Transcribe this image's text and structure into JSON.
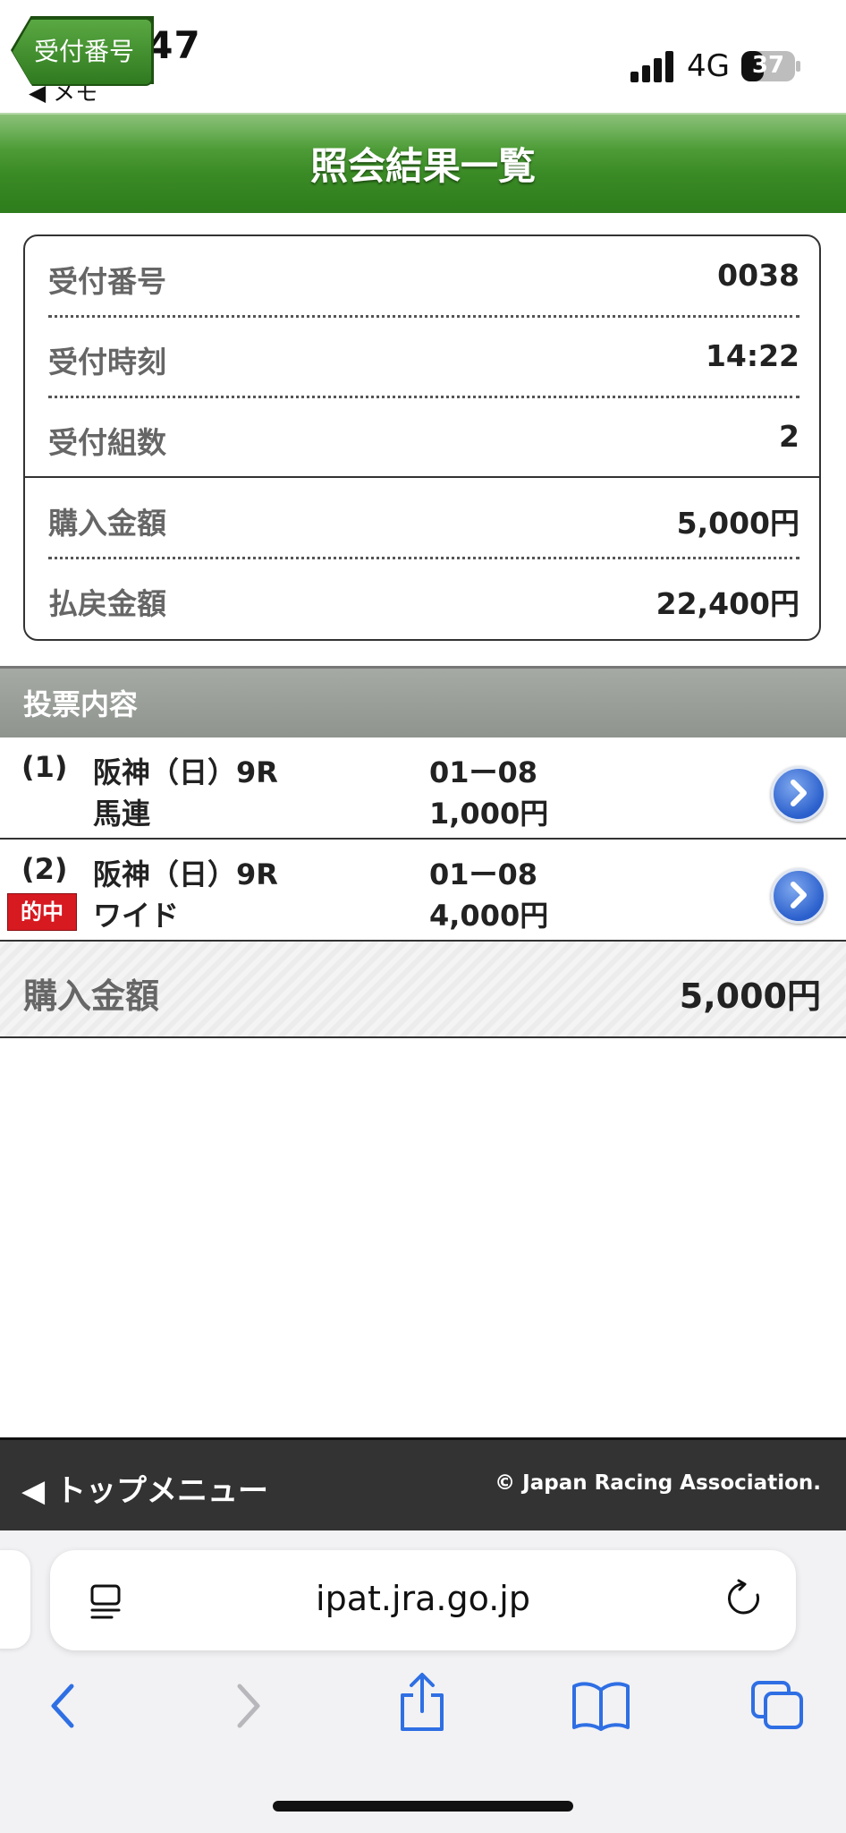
{
  "status_bar": {
    "time": "14:47",
    "back_app": "◀ メモ",
    "network": "4G",
    "battery": "37"
  },
  "header": {
    "back_label": "受付番号",
    "title": "照会結果一覧"
  },
  "summary": [
    {
      "label": "受付番号",
      "value": "0038"
    },
    {
      "label": "受付時刻",
      "value": "14:22"
    },
    {
      "label": "受付組数",
      "value": "2"
    },
    {
      "label": "購入金額",
      "value": "5,000円"
    },
    {
      "label": "払戻金額",
      "value": "22,400円"
    }
  ],
  "section_title": "投票内容",
  "bets": [
    {
      "num": "(1)",
      "race": "阪神（日）9R",
      "type": "馬連",
      "combo": "01ー08",
      "amount": "1,000円",
      "badge": ""
    },
    {
      "num": "(2)",
      "race": "阪神（日）9R",
      "type": "ワイド",
      "combo": "01ー08",
      "amount": "4,000円",
      "badge": "的中"
    }
  ],
  "total": {
    "label": "購入金額",
    "value": "5,000円"
  },
  "footer": {
    "top_menu": "◀ トップメニュー",
    "copyright": "© Japan Racing Association."
  },
  "browser": {
    "url": "ipat.jra.go.jp"
  },
  "colors": {
    "header_green": "#3a8a26",
    "hit_red": "#d71920",
    "link_blue": "#2a5fcc",
    "footer_dark": "#333333"
  }
}
